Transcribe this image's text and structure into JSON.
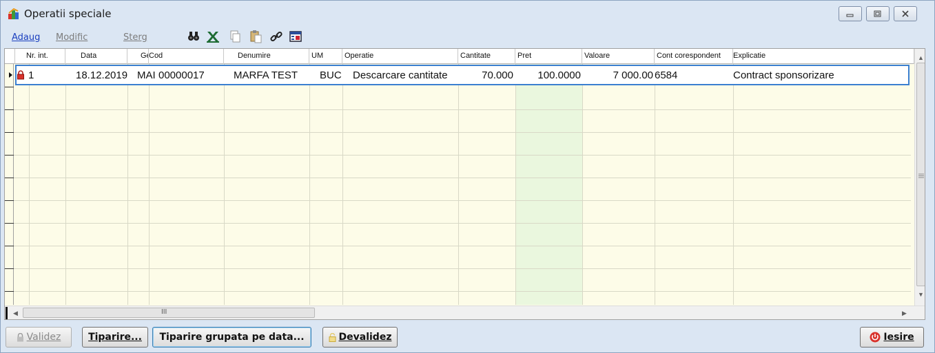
{
  "window": {
    "title": "Operatii speciale"
  },
  "toolbar": {
    "add_label": "Adaug",
    "modify_label": "Modific",
    "delete_label": "Sterg"
  },
  "grid": {
    "columns": [
      "Nr. int.",
      "Data",
      "Gest",
      "Cod",
      "Denumire",
      "UM",
      "Operatie",
      "Cantitate",
      "Pret",
      "Valoare",
      "Cont corespondent",
      "Explicatie"
    ],
    "rows": [
      {
        "nr_int": "1",
        "data": "18.12.2019",
        "gest": "MAI",
        "cod": "00000017",
        "denumire": "MARFA TEST",
        "um": "BUC",
        "operatie": "Descarcare cantitate",
        "cantitate": "70.000",
        "pret": "100.0000",
        "valoare": "7 000.00",
        "cont": "6584",
        "explicatie": "Contract sponsorizare"
      }
    ],
    "hscroll_mark": "III"
  },
  "buttons": {
    "validez": "Validez",
    "tiparire": "Tiparire...",
    "tiparire_grupata": "Tiparire grupata pe data...",
    "devalidez": "Devalidez",
    "iesire": "Iesire"
  },
  "colors": {
    "grid_bg": "#fdfce8",
    "selected_border": "#3a7fd0",
    "link": "#1a3fbf",
    "exit_icon": "#d9322b"
  }
}
